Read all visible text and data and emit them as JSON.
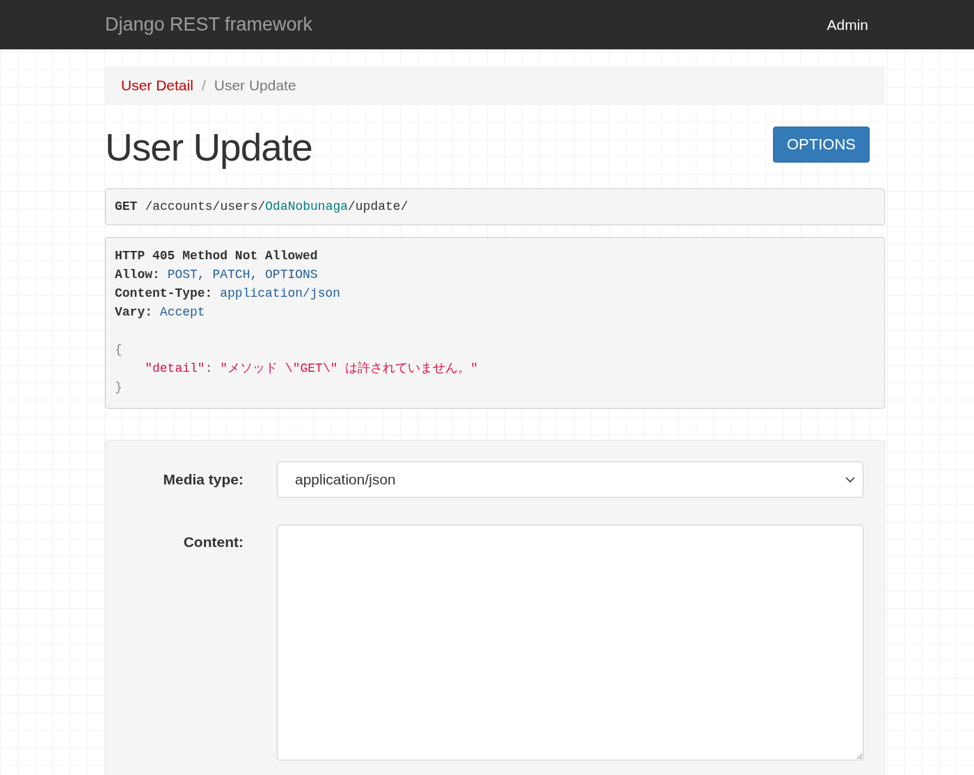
{
  "navbar": {
    "brand": "Django REST framework",
    "user": "Admin"
  },
  "breadcrumb_separator": "/",
  "breadcrumb": [
    {
      "label": "User Detail",
      "active": false
    },
    {
      "label": "User Update",
      "active": true
    }
  ],
  "title": "User Update",
  "options_button": "OPTIONS",
  "request": {
    "method": "GET",
    "path": [
      {
        "text": "/accounts/users/",
        "kind": "plain"
      },
      {
        "text": "OdaNobunaga",
        "kind": "param"
      },
      {
        "text": "/update/",
        "kind": "plain"
      }
    ]
  },
  "response": {
    "status": "HTTP 405 Method Not Allowed",
    "headers": [
      {
        "name": "Allow:",
        "value": "POST, PATCH, OPTIONS"
      },
      {
        "name": "Content-Type:",
        "value": "application/json"
      },
      {
        "name": "Vary:",
        "value": "Accept"
      }
    ],
    "body": {
      "open": "{",
      "key": "\"detail\"",
      "colon": ":",
      "value": "\"メソッド \\\"GET\\\" は許されていません。\"",
      "close": "}"
    }
  },
  "form": {
    "media_type_label": "Media type:",
    "media_type_value": "application/json",
    "content_label": "Content:"
  }
}
